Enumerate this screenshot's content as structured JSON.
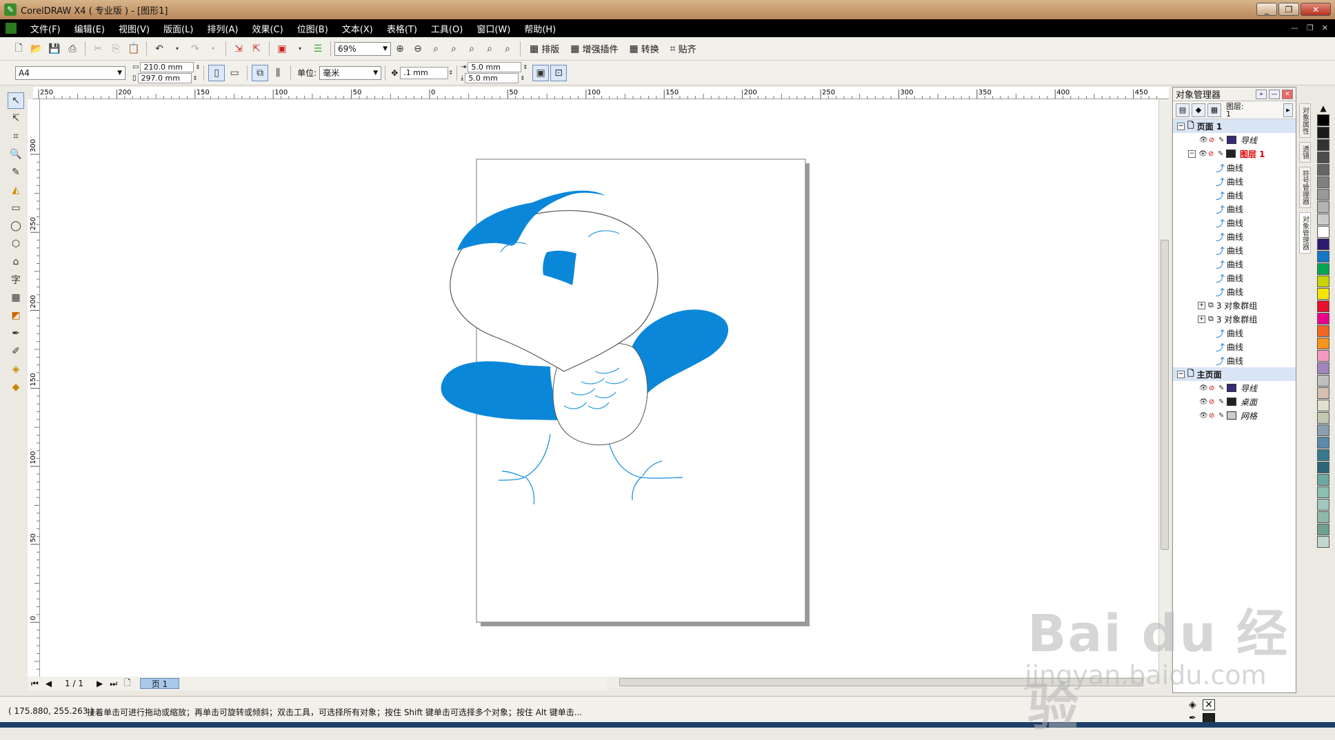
{
  "window": {
    "title": "CorelDRAW X4 ( 专业版 ) - [图形1]"
  },
  "menu": [
    "文件(F)",
    "编辑(E)",
    "视图(V)",
    "版面(L)",
    "排列(A)",
    "效果(C)",
    "位图(B)",
    "文本(X)",
    "表格(T)",
    "工具(O)",
    "窗口(W)",
    "帮助(H)"
  ],
  "toolbar": {
    "zoom": "69%",
    "layout_label": "排版",
    "plugins_label": "增强插件",
    "convert_label": "转换",
    "snap_label": "贴齐"
  },
  "propbar": {
    "paper": "A4",
    "width": "210.0 mm",
    "height": "297.0 mm",
    "units_label": "单位:",
    "units": "毫米",
    "nudge": ".1 mm",
    "dup_x": "5.0 mm",
    "dup_y": "5.0 mm"
  },
  "ruler": {
    "h_ticks": [
      "250",
      "200",
      "150",
      "100",
      "50",
      "0",
      "50",
      "100",
      "150",
      "200",
      "250",
      "300",
      "350",
      "400",
      "450"
    ],
    "v_ticks": [
      "300",
      "250",
      "200",
      "150",
      "100",
      "50",
      "0"
    ]
  },
  "page_nav": {
    "counter": "1 / 1",
    "tab": "页 1"
  },
  "object_manager": {
    "title": "对象管理器",
    "layer_label": "图层:",
    "layer_value": "1",
    "tree": [
      {
        "label": "页面 1",
        "kind": "page"
      },
      {
        "label": "导线",
        "kind": "layer",
        "color": "#3a2a7a",
        "italic": true
      },
      {
        "label": "图层 1",
        "kind": "layer",
        "color": "#222222",
        "active": true
      },
      {
        "label": "曲线",
        "kind": "curve"
      },
      {
        "label": "曲线",
        "kind": "curve"
      },
      {
        "label": "曲线",
        "kind": "curve"
      },
      {
        "label": "曲线",
        "kind": "curve"
      },
      {
        "label": "曲线",
        "kind": "curve"
      },
      {
        "label": "曲线",
        "kind": "curve"
      },
      {
        "label": "曲线",
        "kind": "curve"
      },
      {
        "label": "曲线",
        "kind": "curve"
      },
      {
        "label": "曲线",
        "kind": "curve"
      },
      {
        "label": "曲线",
        "kind": "curve"
      },
      {
        "label": "3 对象群组",
        "kind": "group"
      },
      {
        "label": "3 对象群组",
        "kind": "group"
      },
      {
        "label": "曲线",
        "kind": "curve"
      },
      {
        "label": "曲线",
        "kind": "curve"
      },
      {
        "label": "曲线",
        "kind": "curve"
      },
      {
        "label": "主页面",
        "kind": "page"
      },
      {
        "label": "导线",
        "kind": "layer",
        "color": "#3a2a7a",
        "italic": true
      },
      {
        "label": "桌面",
        "kind": "layer",
        "color": "#222222",
        "italic": true
      },
      {
        "label": "网格",
        "kind": "layer",
        "color": "#cccccc",
        "italic": true
      }
    ]
  },
  "docker_tabs": [
    "对象属性",
    "透镜",
    "符号管理器",
    "对象管理器"
  ],
  "palette": [
    "#000000",
    "#1a1a1a",
    "#333333",
    "#4d4d4d",
    "#666666",
    "#808080",
    "#999999",
    "#b3b3b3",
    "#cccccc",
    "#ffffff",
    "#2e1a6e",
    "#1478c8",
    "#00a651",
    "#c8d400",
    "#f5e400",
    "#e8102a",
    "#ec008c",
    "#f26522",
    "#f7941d",
    "#f49ac1",
    "#a186be",
    "#bfbfbf",
    "#d3c0b0",
    "#e0e0d0",
    "#c0c8b0",
    "#8aa0b0",
    "#5a8aa8",
    "#3a7890",
    "#2a6878",
    "#6aa8a0",
    "#8ac0b0",
    "#a0c8c0",
    "#90b8a8",
    "#70a090",
    "#c0d8d0"
  ],
  "status": {
    "coords": "( 175.880, 255.263 )",
    "hint": "接着单击可进行拖动或缩放；再单击可旋转或倾斜；双击工具，可选择所有对象；按住 Shift 键单击可选择多个对象；按住 Alt 键单击..."
  },
  "watermark": {
    "main": "Bai du 经验",
    "sub": "jingyan.baidu.com"
  },
  "colors": {
    "fill_blue": "#0b87d9",
    "stroke_blue": "#2a9ae0",
    "outline": "#555555"
  }
}
